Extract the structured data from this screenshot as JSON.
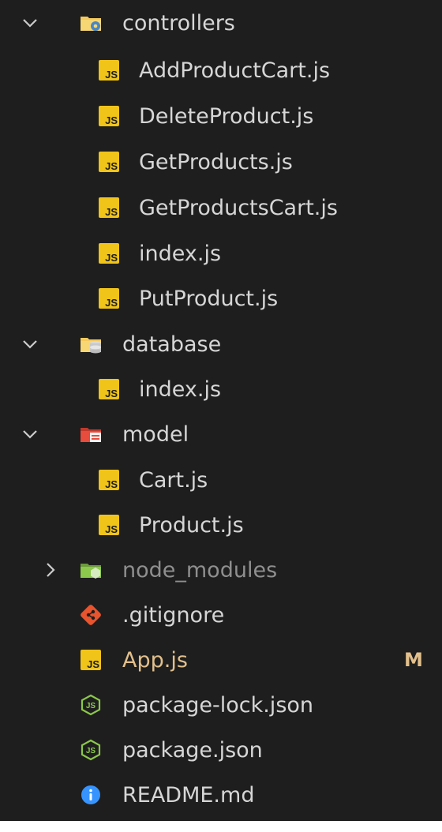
{
  "explorer": {
    "tree": {
      "controllers": {
        "label": "controllers",
        "twisty_icon": "chevron-down-icon",
        "folder_icon": "folder-gear-icon",
        "files": [
          {
            "label": "AddProductCart.js",
            "icon": "js-file-icon"
          },
          {
            "label": "DeleteProduct.js",
            "icon": "js-file-icon"
          },
          {
            "label": "GetProducts.js",
            "icon": "js-file-icon"
          },
          {
            "label": "GetProductsCart.js",
            "icon": "js-file-icon"
          },
          {
            "label": "index.js",
            "icon": "js-file-icon"
          },
          {
            "label": "PutProduct.js",
            "icon": "js-file-icon"
          }
        ]
      },
      "database": {
        "label": "database",
        "twisty_icon": "chevron-down-icon",
        "folder_icon": "folder-database-icon",
        "files": [
          {
            "label": "index.js",
            "icon": "js-file-icon"
          }
        ]
      },
      "model": {
        "label": "model",
        "twisty_icon": "chevron-down-icon",
        "folder_icon": "folder-model-icon",
        "files": [
          {
            "label": "Cart.js",
            "icon": "js-file-icon"
          },
          {
            "label": "Product.js",
            "icon": "js-file-icon"
          }
        ]
      },
      "node_modules": {
        "label": "node_modules",
        "twisty_icon": "chevron-right-icon",
        "folder_icon": "folder-node-icon"
      },
      "root_files": [
        {
          "label": ".gitignore",
          "icon": "git-icon",
          "status": ""
        },
        {
          "label": "App.js",
          "icon": "js-file-icon",
          "status": "M"
        },
        {
          "label": "package-lock.json",
          "icon": "nodejs-icon",
          "status": ""
        },
        {
          "label": "package.json",
          "icon": "nodejs-icon",
          "status": ""
        },
        {
          "label": "README.md",
          "icon": "info-icon",
          "status": ""
        }
      ]
    },
    "colors": {
      "background": "#1e1e1e",
      "text": "#d6d6d6",
      "dim_text": "#8f8f8f",
      "modified": "#e2c08d",
      "js_icon": "#f0c419",
      "git_icon": "#e8542e",
      "node_icon": "#8cc84b",
      "info_icon": "#3794ff"
    }
  }
}
